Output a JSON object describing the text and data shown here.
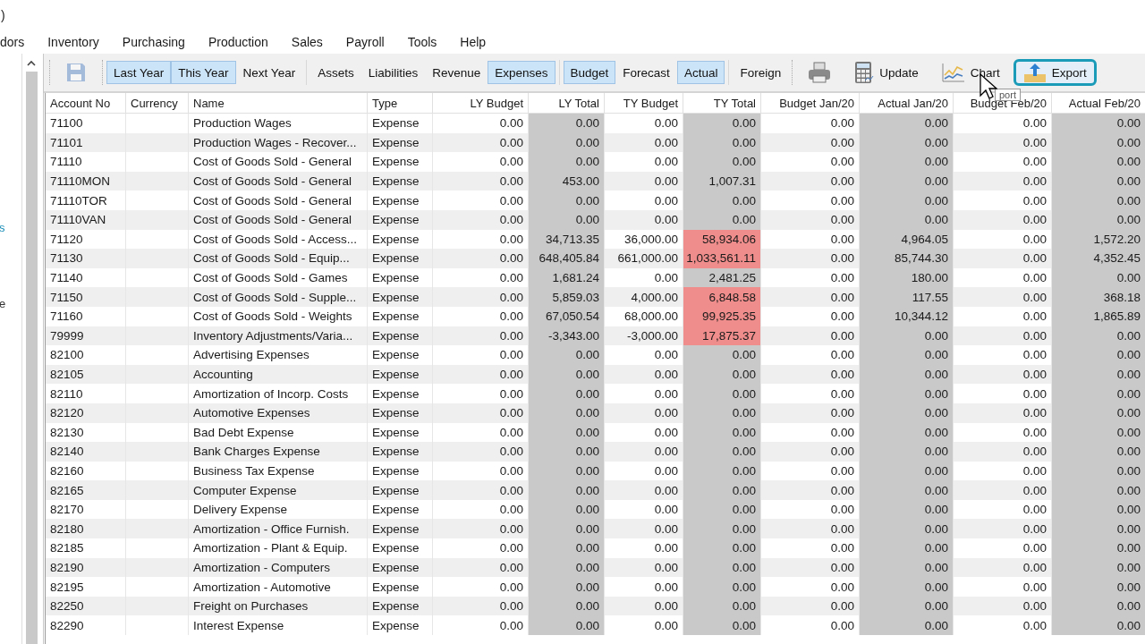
{
  "window": {
    "title": ")"
  },
  "menu": [
    "dors",
    "Inventory",
    "Purchasing",
    "Production",
    "Sales",
    "Payroll",
    "Tools",
    "Help"
  ],
  "sidebar": {
    "fragments": [
      {
        "text": "s",
        "kind": "link"
      },
      {
        "text": "e",
        "kind": "plain"
      }
    ]
  },
  "toolbar": {
    "groups": [
      [
        {
          "kind": "save",
          "disabled": true
        }
      ],
      [
        {
          "kind": "toggle",
          "label": "Last Year",
          "selected": true
        },
        {
          "kind": "toggle",
          "label": "This Year",
          "selected": true
        },
        {
          "kind": "toggle",
          "label": "Next Year",
          "selected": false
        }
      ],
      [
        {
          "kind": "toggle",
          "label": "Assets",
          "selected": false
        },
        {
          "kind": "toggle",
          "label": "Liabilities",
          "selected": false
        },
        {
          "kind": "toggle",
          "label": "Revenue",
          "selected": false
        },
        {
          "kind": "toggle",
          "label": "Expenses",
          "selected": true
        }
      ],
      [
        {
          "kind": "toggle",
          "label": "Budget",
          "selected": true
        },
        {
          "kind": "toggle",
          "label": "Forecast",
          "selected": false
        },
        {
          "kind": "toggle",
          "label": "Actual",
          "selected": true
        }
      ],
      [
        {
          "kind": "toggle",
          "label": "Foreign",
          "selected": false
        }
      ],
      [
        {
          "kind": "print"
        },
        {
          "kind": "update",
          "label": "Update"
        },
        {
          "kind": "chart",
          "label": "Chart"
        },
        {
          "kind": "export",
          "label": "Export",
          "focused": true
        }
      ]
    ]
  },
  "tooltip": "port",
  "table": {
    "columns": [
      {
        "label": "Account No",
        "kind": "text",
        "shaded": false
      },
      {
        "label": "Currency",
        "kind": "text",
        "shaded": false
      },
      {
        "label": "Name",
        "kind": "text",
        "shaded": false
      },
      {
        "label": "Type",
        "kind": "text",
        "shaded": false
      },
      {
        "label": "LY Budget",
        "kind": "amount",
        "shaded": false
      },
      {
        "label": "LY Total",
        "kind": "amount",
        "shaded": true
      },
      {
        "label": "TY Budget",
        "kind": "amount",
        "shaded": false
      },
      {
        "label": "TY Total",
        "kind": "amount",
        "shaded": true
      },
      {
        "label": "Budget Jan/20",
        "kind": "amount",
        "shaded": false
      },
      {
        "label": "Actual Jan/20",
        "kind": "amount",
        "shaded": true
      },
      {
        "label": "Budget Feb/20",
        "kind": "amount",
        "shaded": false
      },
      {
        "label": "Actual Feb/20",
        "kind": "amount",
        "shaded": true
      }
    ],
    "rows": [
      {
        "cells": [
          "71100",
          "",
          "Production Wages",
          "Expense",
          "0.00",
          "0.00",
          "0.00",
          "0.00",
          "0.00",
          "0.00",
          "0.00",
          "0.00"
        ],
        "over_budget": false
      },
      {
        "cells": [
          "71101",
          "",
          "Production Wages - Recover...",
          "Expense",
          "0.00",
          "0.00",
          "0.00",
          "0.00",
          "0.00",
          "0.00",
          "0.00",
          "0.00"
        ],
        "over_budget": false
      },
      {
        "cells": [
          "71110",
          "",
          "Cost of Goods Sold - General",
          "Expense",
          "0.00",
          "0.00",
          "0.00",
          "0.00",
          "0.00",
          "0.00",
          "0.00",
          "0.00"
        ],
        "over_budget": false
      },
      {
        "cells": [
          "71110MON",
          "",
          "Cost of Goods Sold - General",
          "Expense",
          "0.00",
          "453.00",
          "0.00",
          "1,007.31",
          "0.00",
          "0.00",
          "0.00",
          "0.00"
        ],
        "over_budget": false
      },
      {
        "cells": [
          "71110TOR",
          "",
          "Cost of Goods Sold - General",
          "Expense",
          "0.00",
          "0.00",
          "0.00",
          "0.00",
          "0.00",
          "0.00",
          "0.00",
          "0.00"
        ],
        "over_budget": false
      },
      {
        "cells": [
          "71110VAN",
          "",
          "Cost of Goods Sold - General",
          "Expense",
          "0.00",
          "0.00",
          "0.00",
          "0.00",
          "0.00",
          "0.00",
          "0.00",
          "0.00"
        ],
        "over_budget": false
      },
      {
        "cells": [
          "71120",
          "",
          "Cost of Goods Sold - Access...",
          "Expense",
          "0.00",
          "34,713.35",
          "36,000.00",
          "58,934.06",
          "0.00",
          "4,964.05",
          "0.00",
          "1,572.20"
        ],
        "over_budget": true
      },
      {
        "cells": [
          "71130",
          "",
          "Cost of Goods Sold - Equip...",
          "Expense",
          "0.00",
          "648,405.84",
          "661,000.00",
          "1,033,561.11",
          "0.00",
          "85,744.30",
          "0.00",
          "4,352.45"
        ],
        "over_budget": true
      },
      {
        "cells": [
          "71140",
          "",
          "Cost of Goods Sold - Games",
          "Expense",
          "0.00",
          "1,681.24",
          "0.00",
          "2,481.25",
          "0.00",
          "180.00",
          "0.00",
          "0.00"
        ],
        "over_budget": false
      },
      {
        "cells": [
          "71150",
          "",
          "Cost of Goods Sold - Supple...",
          "Expense",
          "0.00",
          "5,859.03",
          "4,000.00",
          "6,848.58",
          "0.00",
          "117.55",
          "0.00",
          "368.18"
        ],
        "over_budget": true
      },
      {
        "cells": [
          "71160",
          "",
          "Cost of Goods Sold - Weights",
          "Expense",
          "0.00",
          "67,050.54",
          "68,000.00",
          "99,925.35",
          "0.00",
          "10,344.12",
          "0.00",
          "1,865.89"
        ],
        "over_budget": true
      },
      {
        "cells": [
          "79999",
          "",
          "Inventory Adjustments/Varia...",
          "Expense",
          "0.00",
          "-3,343.00",
          "-3,000.00",
          "17,875.37",
          "0.00",
          "0.00",
          "0.00",
          "0.00"
        ],
        "over_budget": true
      },
      {
        "cells": [
          "82100",
          "",
          "Advertising Expenses",
          "Expense",
          "0.00",
          "0.00",
          "0.00",
          "0.00",
          "0.00",
          "0.00",
          "0.00",
          "0.00"
        ],
        "over_budget": false
      },
      {
        "cells": [
          "82105",
          "",
          "Accounting",
          "Expense",
          "0.00",
          "0.00",
          "0.00",
          "0.00",
          "0.00",
          "0.00",
          "0.00",
          "0.00"
        ],
        "over_budget": false
      },
      {
        "cells": [
          "82110",
          "",
          "Amortization of Incorp. Costs",
          "Expense",
          "0.00",
          "0.00",
          "0.00",
          "0.00",
          "0.00",
          "0.00",
          "0.00",
          "0.00"
        ],
        "over_budget": false
      },
      {
        "cells": [
          "82120",
          "",
          "Automotive Expenses",
          "Expense",
          "0.00",
          "0.00",
          "0.00",
          "0.00",
          "0.00",
          "0.00",
          "0.00",
          "0.00"
        ],
        "over_budget": false
      },
      {
        "cells": [
          "82130",
          "",
          "Bad Debt Expense",
          "Expense",
          "0.00",
          "0.00",
          "0.00",
          "0.00",
          "0.00",
          "0.00",
          "0.00",
          "0.00"
        ],
        "over_budget": false
      },
      {
        "cells": [
          "82140",
          "",
          "Bank Charges Expense",
          "Expense",
          "0.00",
          "0.00",
          "0.00",
          "0.00",
          "0.00",
          "0.00",
          "0.00",
          "0.00"
        ],
        "over_budget": false
      },
      {
        "cells": [
          "82160",
          "",
          "Business Tax Expense",
          "Expense",
          "0.00",
          "0.00",
          "0.00",
          "0.00",
          "0.00",
          "0.00",
          "0.00",
          "0.00"
        ],
        "over_budget": false
      },
      {
        "cells": [
          "82165",
          "",
          "Computer Expense",
          "Expense",
          "0.00",
          "0.00",
          "0.00",
          "0.00",
          "0.00",
          "0.00",
          "0.00",
          "0.00"
        ],
        "over_budget": false
      },
      {
        "cells": [
          "82170",
          "",
          "Delivery Expense",
          "Expense",
          "0.00",
          "0.00",
          "0.00",
          "0.00",
          "0.00",
          "0.00",
          "0.00",
          "0.00"
        ],
        "over_budget": false
      },
      {
        "cells": [
          "82180",
          "",
          "Amortization - Office Furnish.",
          "Expense",
          "0.00",
          "0.00",
          "0.00",
          "0.00",
          "0.00",
          "0.00",
          "0.00",
          "0.00"
        ],
        "over_budget": false
      },
      {
        "cells": [
          "82185",
          "",
          "Amortization - Plant & Equip.",
          "Expense",
          "0.00",
          "0.00",
          "0.00",
          "0.00",
          "0.00",
          "0.00",
          "0.00",
          "0.00"
        ],
        "over_budget": false
      },
      {
        "cells": [
          "82190",
          "",
          "Amortization - Computers",
          "Expense",
          "0.00",
          "0.00",
          "0.00",
          "0.00",
          "0.00",
          "0.00",
          "0.00",
          "0.00"
        ],
        "over_budget": false
      },
      {
        "cells": [
          "82195",
          "",
          "Amortization - Automotive",
          "Expense",
          "0.00",
          "0.00",
          "0.00",
          "0.00",
          "0.00",
          "0.00",
          "0.00",
          "0.00"
        ],
        "over_budget": false
      },
      {
        "cells": [
          "82250",
          "",
          "Freight on Purchases",
          "Expense",
          "0.00",
          "0.00",
          "0.00",
          "0.00",
          "0.00",
          "0.00",
          "0.00",
          "0.00"
        ],
        "over_budget": false
      },
      {
        "cells": [
          "82290",
          "",
          "Interest Expense",
          "Expense",
          "0.00",
          "0.00",
          "0.00",
          "0.00",
          "0.00",
          "0.00",
          "0.00",
          "0.00"
        ],
        "over_budget": false
      }
    ]
  }
}
